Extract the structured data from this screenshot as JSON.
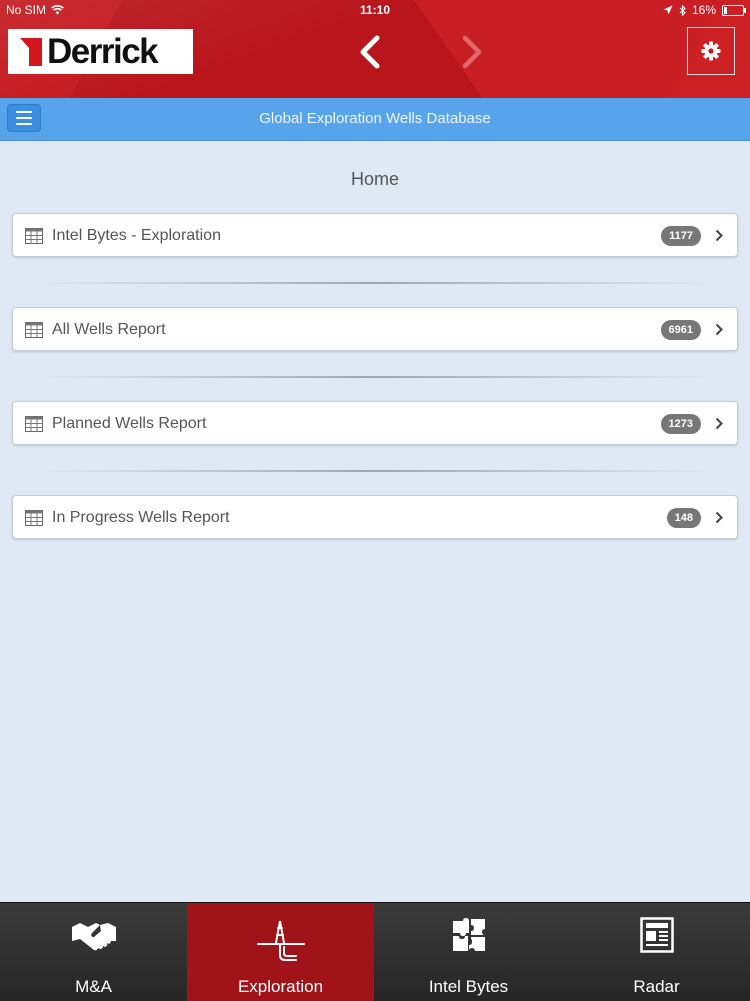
{
  "status_bar": {
    "carrier": "No SIM",
    "time": "11:10",
    "battery": "16%",
    "battery_level": 0.16
  },
  "header": {
    "logo_text": "Derrick",
    "back_icon": "chevron-left-icon",
    "forward_icon": "chevron-right-icon",
    "settings_icon": "gear-icon"
  },
  "title_bar": {
    "title": "Global Exploration Wells Database",
    "menu_icon": "hamburger-icon"
  },
  "page": {
    "heading": "Home"
  },
  "reports": [
    {
      "label": "Intel Bytes - Exploration",
      "count": "1177"
    },
    {
      "label": "All Wells Report",
      "count": "6961"
    },
    {
      "label": "Planned Wells Report",
      "count": "1273"
    },
    {
      "label": "In Progress Wells Report",
      "count": "148"
    }
  ],
  "tabs": [
    {
      "label": "M&A",
      "icon": "handshake-icon",
      "active": false
    },
    {
      "label": "Exploration",
      "icon": "oil-rig-icon",
      "active": true
    },
    {
      "label": "Intel Bytes",
      "icon": "puzzle-icon",
      "active": false
    },
    {
      "label": "Radar",
      "icon": "newspaper-icon",
      "active": false
    }
  ],
  "colors": {
    "brand_red": "#c41a1f",
    "title_blue": "#58a4ec",
    "active_tab": "#a01419",
    "badge_gray": "#777777"
  }
}
